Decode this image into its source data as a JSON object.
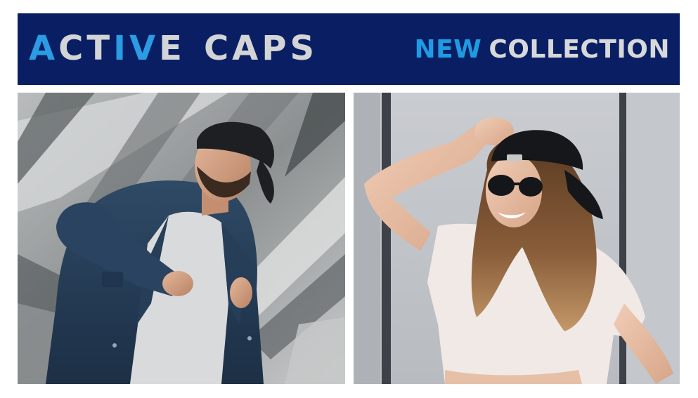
{
  "banner": {
    "brand": {
      "word1_letters": [
        "A",
        "C",
        "T",
        "I",
        "V",
        "E"
      ],
      "word1_colors": [
        "blue",
        "grey",
        "grey",
        "blue",
        "blue",
        "grey"
      ],
      "word2": "CAPS"
    },
    "tagline": {
      "part1": "NEW",
      "part2": "COLLECTION"
    }
  },
  "colors": {
    "banner_bg": "#0a1f63",
    "accent_blue": "#2b9be3",
    "light_grey": "#d3d4d6"
  },
  "photos": [
    {
      "subject": "man in denim jacket and black backwards cap"
    },
    {
      "subject": "smiling woman in sunglasses and black backwards cap"
    }
  ]
}
